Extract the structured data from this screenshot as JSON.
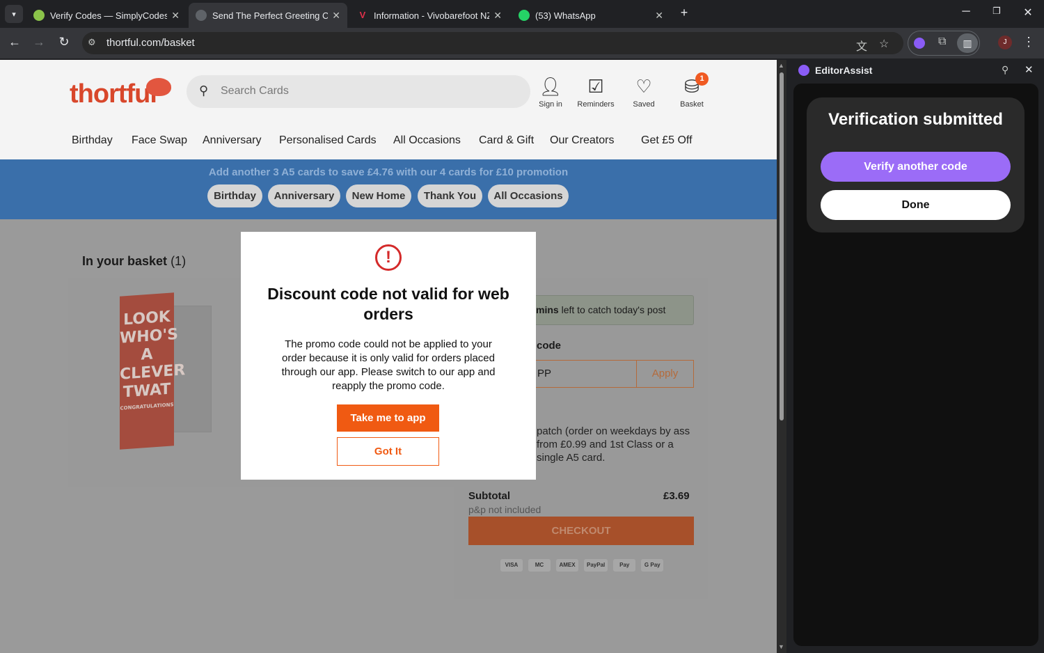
{
  "browser": {
    "tabs": [
      {
        "title": "Verify Codes — SimplyCodes",
        "active": false,
        "favicon": "simplycodes-icon"
      },
      {
        "title": "Send The Perfect Greeting Card",
        "active": true,
        "favicon": "globe-icon"
      },
      {
        "title": "Information - Vivobarefoot NZ",
        "active": false,
        "favicon": "vivobarefoot-icon"
      },
      {
        "title": "(53) WhatsApp",
        "active": false,
        "favicon": "whatsapp-icon"
      }
    ],
    "url": "thortful.com/basket",
    "profile_initial": "J"
  },
  "site": {
    "logo": "thortful",
    "search_placeholder": "Search Cards",
    "header_icons": {
      "sign_in": "Sign in",
      "reminders": "Reminders",
      "saved": "Saved",
      "basket": "Basket",
      "basket_count": "1"
    },
    "nav": [
      "Birthday",
      "Face Swap",
      "Anniversary",
      "Personalised Cards",
      "All Occasions",
      "Card & Gift",
      "Our Creators",
      "Get £5 Off"
    ],
    "promo": {
      "text": "Add another 3 A5 cards to save £4.76 with our 4 cards for £10 promotion",
      "chips": [
        "Birthday",
        "Anniversary",
        "New Home",
        "Thank You",
        "All Occasions"
      ]
    },
    "basket": {
      "title": "In your basket",
      "count": "(1)",
      "card_text": "LOOK WHO'S A CLEVER TWAT",
      "card_subtext": "CONGRATULATIONS",
      "post_bold": "mins",
      "post_rest": " left to catch today's post",
      "code_label": "code",
      "code_value": "PP",
      "apply": "Apply",
      "dispatch": "patch (order on weekdays by ass from £0.99 and 1st Class or a single A5 card.",
      "subtotal_label": "Subtotal",
      "subtotal_value": "£3.69",
      "pp_note": "p&p not included",
      "checkout": "CHECKOUT",
      "payments": [
        "VISA",
        "MC",
        "AMEX",
        "PayPal",
        "Pay",
        "G Pay"
      ]
    }
  },
  "modal": {
    "title": "Discount code not valid for web orders",
    "body": "The promo code could not be applied to your order because it is only valid for orders placed through our app. Please switch to our app and reapply the promo code.",
    "primary": "Take me to app",
    "secondary": "Got It"
  },
  "side_panel": {
    "title": "EditorAssist",
    "heading": "Verification submitted",
    "verify_button": "Verify another code",
    "done_button": "Done"
  },
  "colors": {
    "brand_orange": "#f05a12",
    "promo_blue": "#3a6faa",
    "verify_purple": "#9b6cf7",
    "error_red": "#d42a2a"
  }
}
